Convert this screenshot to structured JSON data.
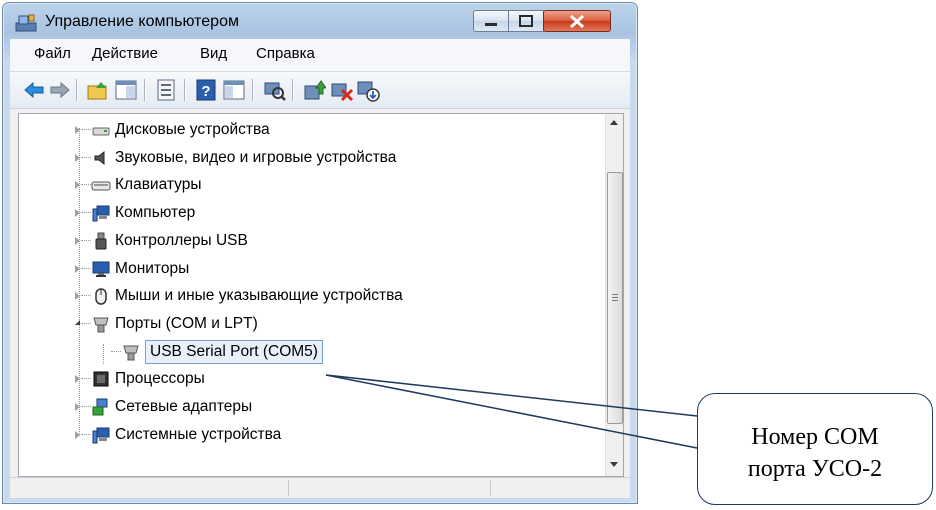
{
  "window": {
    "title": "Управление компьютером"
  },
  "menu": {
    "items": [
      "Файл",
      "Действие",
      "Вид",
      "Справка"
    ]
  },
  "toolbar": {
    "buttons": [
      "back-arrow-icon",
      "forward-arrow-icon",
      "up-folder-icon",
      "show-hide-tree-icon",
      "properties-icon",
      "help-icon",
      "action-pane-icon",
      "scan-hardware-icon",
      "update-driver-icon",
      "uninstall-device-icon",
      "disable-device-icon"
    ]
  },
  "tree": {
    "items": [
      {
        "label": "Дисковые устройства",
        "icon": "disk-drive-icon",
        "expanded": false
      },
      {
        "label": "Звуковые, видео и игровые устройства",
        "icon": "speaker-icon",
        "expanded": false
      },
      {
        "label": "Клавиатуры",
        "icon": "keyboard-icon",
        "expanded": false
      },
      {
        "label": "Компьютер",
        "icon": "computer-icon",
        "expanded": false
      },
      {
        "label": "Контроллеры USB",
        "icon": "usb-plug-icon",
        "expanded": false
      },
      {
        "label": "Мониторы",
        "icon": "monitor-icon",
        "expanded": false
      },
      {
        "label": "Мыши и иные указывающие устройства",
        "icon": "mouse-icon",
        "expanded": false
      },
      {
        "label": "Порты (COM и LPT)",
        "icon": "port-icon",
        "expanded": true
      },
      {
        "label": "USB Serial Port (COM5)",
        "icon": "port-icon",
        "child": true
      },
      {
        "label": "Процессоры",
        "icon": "processor-icon",
        "expanded": false
      },
      {
        "label": "Сетевые адаптеры",
        "icon": "network-adapter-icon",
        "expanded": false
      },
      {
        "label": "Системные устройства",
        "icon": "system-device-icon",
        "expanded": false
      }
    ]
  },
  "callout": {
    "line1": "Номер COM",
    "line2": "порта УСО-2"
  },
  "colors": {
    "callout_border": "#1f3a60",
    "selection_border": "#7da2ce",
    "window_frame": "#a9c4e2"
  }
}
